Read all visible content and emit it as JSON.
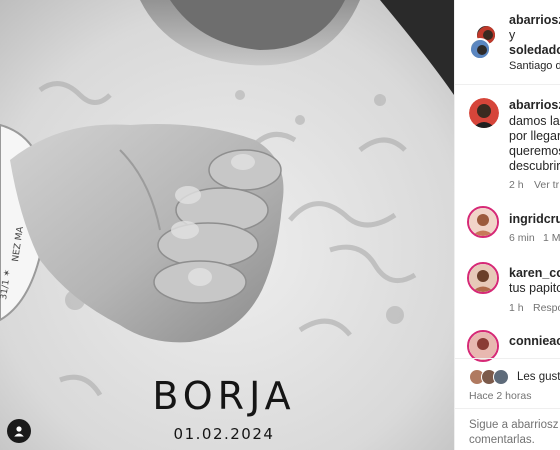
{
  "post": {
    "baby_name": "BORJA",
    "baby_date": "01.02.2024"
  },
  "header": {
    "username_primary": "abarriosz",
    "connector": "y",
    "username_secondary": "soledador",
    "location": "Santiago de"
  },
  "caption": {
    "username": "abarriosz",
    "lines": [
      "damos la",
      "por llegar",
      "queremos",
      "descubrir tr"
    ],
    "time": "2 h",
    "translate_label": "Ver tr"
  },
  "comments": [
    {
      "username": "ingridcruz",
      "text": "",
      "time": "6 min",
      "likes": "1 M"
    },
    {
      "username": "karen_cor",
      "text": "tus papito",
      "time": "1 h",
      "reply_label": "Respo"
    },
    {
      "username": "conniеach",
      "text": "",
      "time": "",
      "likes": ""
    }
  ],
  "likes": {
    "text": "Les gusta",
    "time_ago": "Hace 2 horas"
  },
  "comment_input": {
    "line1": "Sigue a abarriosz p",
    "line2": "comentarlas."
  }
}
